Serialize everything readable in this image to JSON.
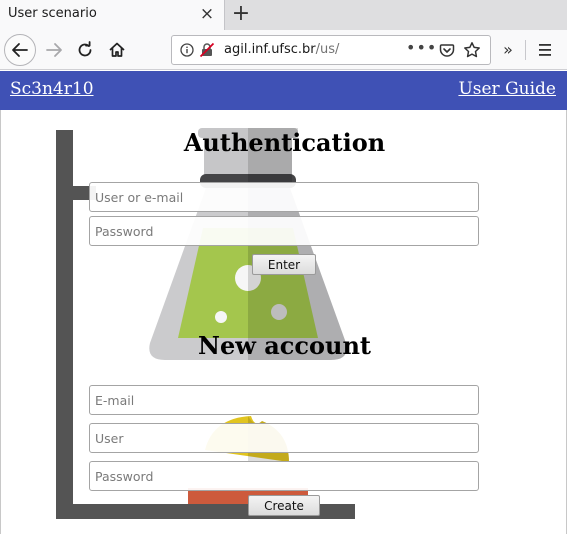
{
  "browser": {
    "tab_title": "User scenario",
    "tab_close": "×",
    "new_tab": "+",
    "url_host": "agil.inf.ufsc.br",
    "url_path": "/us/",
    "url_more": "•••",
    "overflow": "»"
  },
  "header": {
    "brand": "Sc3n4r10",
    "guide": "User Guide"
  },
  "auth": {
    "title": "Authentication",
    "user_placeholder": "User or e-mail",
    "password_placeholder": "Password",
    "enter_label": "Enter"
  },
  "signup": {
    "title": "New account",
    "email_placeholder": "E-mail",
    "user_placeholder": "User",
    "password_placeholder": "Password",
    "create_label": "Create"
  },
  "colors": {
    "header_bg": "#3f51b5",
    "flask_liquid": "#a4c64d",
    "flame_yellow": "#e1c41f",
    "burner_red": "#cd5a3c",
    "stand": "#545454"
  }
}
